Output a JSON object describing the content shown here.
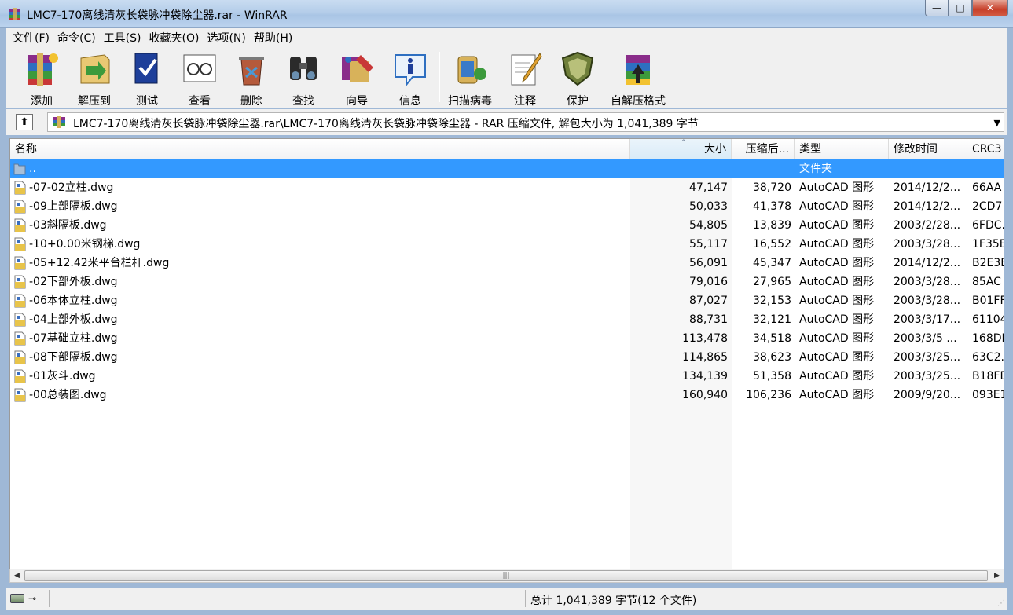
{
  "window": {
    "title": "LMC7-170离线清灰长袋脉冲袋除尘器.rar - WinRAR",
    "minimize_glyph": "—",
    "maximize_glyph": "□",
    "close_glyph": "✕"
  },
  "menu": [
    "文件(F)",
    "命令(C)",
    "工具(S)",
    "收藏夹(O)",
    "选项(N)",
    "帮助(H)"
  ],
  "toolbar": [
    {
      "label": "添加",
      "icon": "add-archive-icon"
    },
    {
      "label": "解压到",
      "icon": "extract-to-icon"
    },
    {
      "label": "测试",
      "icon": "test-icon"
    },
    {
      "label": "查看",
      "icon": "view-icon"
    },
    {
      "label": "删除",
      "icon": "delete-icon"
    },
    {
      "label": "查找",
      "icon": "find-icon"
    },
    {
      "label": "向导",
      "icon": "wizard-icon"
    },
    {
      "label": "信息",
      "icon": "info-icon"
    },
    {
      "label": "扫描病毒",
      "icon": "virus-scan-icon"
    },
    {
      "label": "注释",
      "icon": "comment-icon"
    },
    {
      "label": "保护",
      "icon": "protect-icon"
    },
    {
      "label": "自解压格式",
      "icon": "sfx-icon"
    }
  ],
  "address": {
    "up_glyph": "⬆",
    "path": "LMC7-170离线清灰长袋脉冲袋除尘器.rar\\LMC7-170离线清灰长袋脉冲袋除尘器 - RAR 压缩文件, 解包大小为 1,041,389 字节",
    "dropdown_glyph": "▼"
  },
  "columns": {
    "name": "名称",
    "size": "大小",
    "packed": "压缩后...",
    "type": "类型",
    "modified": "修改时间",
    "crc": "CRC3",
    "sort_glyph": "^"
  },
  "parent_row": {
    "name": "..",
    "type": "文件夹"
  },
  "files": [
    {
      "name": "-07-02立柱.dwg",
      "size": "47,147",
      "packed": "38,720",
      "type": "AutoCAD 图形",
      "modified": "2014/12/2...",
      "crc": "66AA"
    },
    {
      "name": "-09上部隔板.dwg",
      "size": "50,033",
      "packed": "41,378",
      "type": "AutoCAD 图形",
      "modified": "2014/12/2...",
      "crc": "2CD7"
    },
    {
      "name": "-03斜隔板.dwg",
      "size": "54,805",
      "packed": "13,839",
      "type": "AutoCAD 图形",
      "modified": "2003/2/28...",
      "crc": "6FDC."
    },
    {
      "name": "-10+0.00米钢梯.dwg",
      "size": "55,117",
      "packed": "16,552",
      "type": "AutoCAD 图形",
      "modified": "2003/3/28...",
      "crc": "1F35E"
    },
    {
      "name": "-05+12.42米平台栏杆.dwg",
      "size": "56,091",
      "packed": "45,347",
      "type": "AutoCAD 图形",
      "modified": "2014/12/2...",
      "crc": "B2E3E"
    },
    {
      "name": "-02下部外板.dwg",
      "size": "79,016",
      "packed": "27,965",
      "type": "AutoCAD 图形",
      "modified": "2003/3/28...",
      "crc": "85AC"
    },
    {
      "name": "-06本体立柱.dwg",
      "size": "87,027",
      "packed": "32,153",
      "type": "AutoCAD 图形",
      "modified": "2003/3/28...",
      "crc": "B01FF"
    },
    {
      "name": "-04上部外板.dwg",
      "size": "88,731",
      "packed": "32,121",
      "type": "AutoCAD 图形",
      "modified": "2003/3/17...",
      "crc": "61104"
    },
    {
      "name": "-07基础立柱.dwg",
      "size": "113,478",
      "packed": "34,518",
      "type": "AutoCAD 图形",
      "modified": "2003/3/5 ...",
      "crc": "168DI"
    },
    {
      "name": "-08下部隔板.dwg",
      "size": "114,865",
      "packed": "38,623",
      "type": "AutoCAD 图形",
      "modified": "2003/3/25...",
      "crc": "63C2."
    },
    {
      "name": "-01灰斗.dwg",
      "size": "134,139",
      "packed": "51,358",
      "type": "AutoCAD 图形",
      "modified": "2003/3/25...",
      "crc": "B18FD"
    },
    {
      "name": "-00总装图.dwg",
      "size": "160,940",
      "packed": "106,236",
      "type": "AutoCAD 图形",
      "modified": "2009/9/20...",
      "crc": "093E1"
    }
  ],
  "scrollbar": {
    "left_glyph": "◀",
    "right_glyph": "▶",
    "thumb_grip": "|||"
  },
  "status": {
    "key_glyph": "⊸",
    "total": "总计 1,041,389 字节(12 个文件)",
    "grip_glyph": "⋰"
  }
}
